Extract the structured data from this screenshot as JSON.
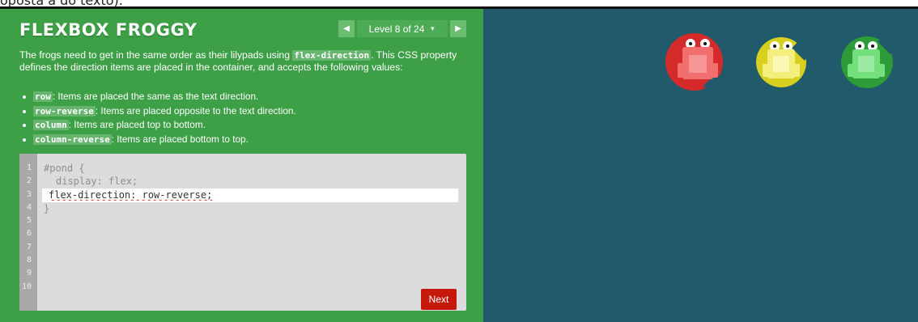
{
  "browser_fragment": "oposta a do texto).",
  "header": {
    "title": "FLEXBOX FROGGY",
    "level_label": "Level 8 of 24",
    "level_caret": "▼",
    "prev_arrow": "◀",
    "next_arrow": "▶"
  },
  "instructions": {
    "intro_before": "The frogs need to get in the same order as their lilypads using ",
    "intro_code": "flex-direction",
    "intro_after": ". This CSS property defines the direction items are placed in the container, and accepts the following values:",
    "values": [
      {
        "code": "row",
        "text": ": Items are placed the same as the text direction."
      },
      {
        "code": "row-reverse",
        "text": ": Items are placed opposite to the text direction."
      },
      {
        "code": "column",
        "text": ": Items are placed top to bottom."
      },
      {
        "code": "column-reverse",
        "text": ": Items are placed bottom to top."
      }
    ]
  },
  "editor": {
    "line_numbers": [
      "1",
      "2",
      "3",
      "4",
      "5",
      "6",
      "7",
      "8",
      "9",
      "10"
    ],
    "line1": "#pond {",
    "line2": "display: flex;",
    "input_value": "flex-direction: row-reverse;",
    "line4": "}",
    "next_label": "Next"
  },
  "pond": {
    "lilypads": [
      "red",
      "yellow",
      "green"
    ],
    "colors": {
      "red_pad": "#d42a2a",
      "red_frog": "#f26f6f",
      "yellow_pad": "#d8d021",
      "yellow_frog": "#f4ef7c",
      "green_pad": "#2d9b38",
      "green_frog": "#74e07b",
      "water": "#215a6b",
      "panel": "#3d9f46"
    }
  }
}
